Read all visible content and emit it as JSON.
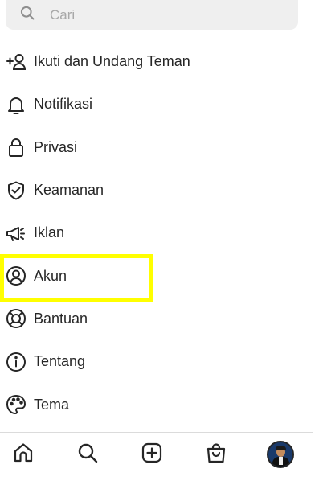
{
  "search": {
    "placeholder": "Cari",
    "icon": "search-icon"
  },
  "menu": {
    "items": [
      {
        "label": "Ikuti dan Undang Teman",
        "icon": "add-person-icon"
      },
      {
        "label": "Notifikasi",
        "icon": "bell-icon"
      },
      {
        "label": "Privasi",
        "icon": "lock-icon"
      },
      {
        "label": "Keamanan",
        "icon": "shield-check-icon"
      },
      {
        "label": "Iklan",
        "icon": "megaphone-icon"
      },
      {
        "label": "Akun",
        "icon": "account-circle-icon"
      },
      {
        "label": "Bantuan",
        "icon": "lifebuoy-icon"
      },
      {
        "label": "Tentang",
        "icon": "info-icon"
      },
      {
        "label": "Tema",
        "icon": "palette-icon"
      }
    ]
  },
  "highlight": {
    "target": "Akun",
    "color": "#ffff00"
  },
  "bottom_nav": {
    "items": [
      "home-icon",
      "search-icon",
      "add-post-icon",
      "shop-icon",
      "profile-avatar"
    ]
  }
}
